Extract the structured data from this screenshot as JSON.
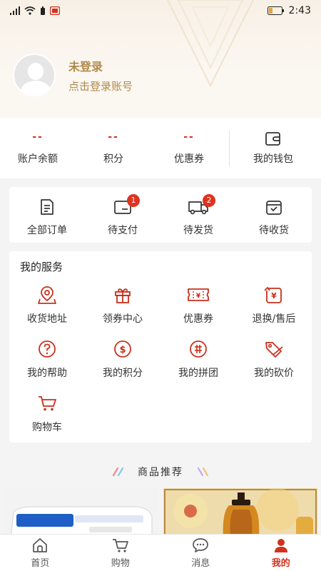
{
  "status_bar": {
    "time": "2:43"
  },
  "profile": {
    "name": "未登录",
    "subtitle": "点击登录账号"
  },
  "stats": [
    {
      "value": "--",
      "label": "账户余额"
    },
    {
      "value": "--",
      "label": "积分"
    },
    {
      "value": "--",
      "label": "优惠券"
    }
  ],
  "wallet": {
    "label": "我的钱包"
  },
  "orders": [
    {
      "label": "全部订单",
      "icon": "order-list-icon",
      "badge": ""
    },
    {
      "label": "待支付",
      "icon": "wallet-pay-icon",
      "badge": "1"
    },
    {
      "label": "待发货",
      "icon": "truck-icon",
      "badge": "2"
    },
    {
      "label": "待收货",
      "icon": "received-box-icon",
      "badge": ""
    }
  ],
  "services": {
    "title": "我的服务",
    "items": [
      {
        "label": "收货地址",
        "icon": "location-icon"
      },
      {
        "label": "领券中心",
        "icon": "gift-icon"
      },
      {
        "label": "优惠券",
        "icon": "coupon-icon"
      },
      {
        "label": "退换/售后",
        "icon": "refund-icon"
      },
      {
        "label": "我的帮助",
        "icon": "help-icon"
      },
      {
        "label": "我的积分",
        "icon": "points-icon"
      },
      {
        "label": "我的拼团",
        "icon": "group-buy-icon"
      },
      {
        "label": "我的砍价",
        "icon": "bargain-tag-icon"
      },
      {
        "label": "购物车",
        "icon": "cart-icon"
      }
    ]
  },
  "recommend": {
    "title": "商品推荐"
  },
  "tabbar": [
    {
      "label": "首页",
      "icon": "home-icon",
      "active": false
    },
    {
      "label": "购物",
      "icon": "shopping-cart-icon",
      "active": false
    },
    {
      "label": "消息",
      "icon": "message-icon",
      "active": false
    },
    {
      "label": "我的",
      "icon": "user-icon",
      "active": true
    }
  ],
  "colors": {
    "accent": "#d0321e",
    "gold": "#b08a4a"
  }
}
